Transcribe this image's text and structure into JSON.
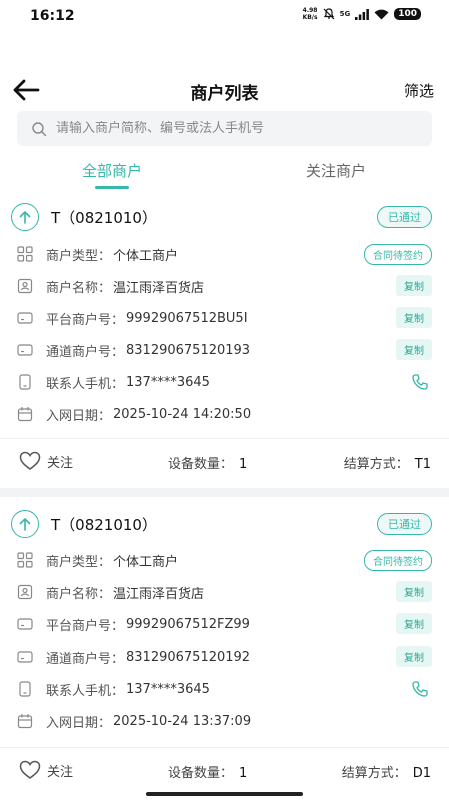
{
  "status_bar": {
    "time": "16:12",
    "net_speed_value": "4.98",
    "net_speed_unit": "KB/s",
    "network": "5G",
    "battery": "100"
  },
  "nav": {
    "title": "商户列表",
    "filter_label": "筛选"
  },
  "search": {
    "placeholder": "请输入商户简称、编号或法人手机号"
  },
  "tabs": [
    {
      "label": "全部商户",
      "active": true
    },
    {
      "label": "关注商户",
      "active": false
    }
  ],
  "labels": {
    "type": "商户类型：",
    "name": "商户名称：",
    "platform_no": "平台商户号：",
    "channel_no": "通道商户号：",
    "contact_phone": "联系人手机：",
    "join_date": "入网日期：",
    "copy": "复制",
    "follow": "关注",
    "device_count": "设备数量：",
    "settlement": "结算方式："
  },
  "merchants": [
    {
      "title": "T（0821010）",
      "status": "已通过",
      "type": "个体工商户",
      "contract_status": "合同待签约",
      "name": "温江雨泽百货店",
      "platform_no": "99929067512BU5I",
      "channel_no": "831290675120193",
      "contact_phone": "137****3645",
      "join_date": "2025-10-24 14:20:50",
      "device_count": "1",
      "settlement": "T1"
    },
    {
      "title": "T（0821010）",
      "status": "已通过",
      "type": "个体工商户",
      "contract_status": "合同待签约",
      "name": "温江雨泽百货店",
      "platform_no": "99929067512FZ99",
      "channel_no": "831290675120192",
      "contact_phone": "137****3645",
      "join_date": "2025-10-24 13:37:09",
      "device_count": "1",
      "settlement": "D1"
    }
  ],
  "colors": {
    "accent": "#35b8a9",
    "copy_bg": "#e6f6f3",
    "divider": "#f2f3f5"
  }
}
